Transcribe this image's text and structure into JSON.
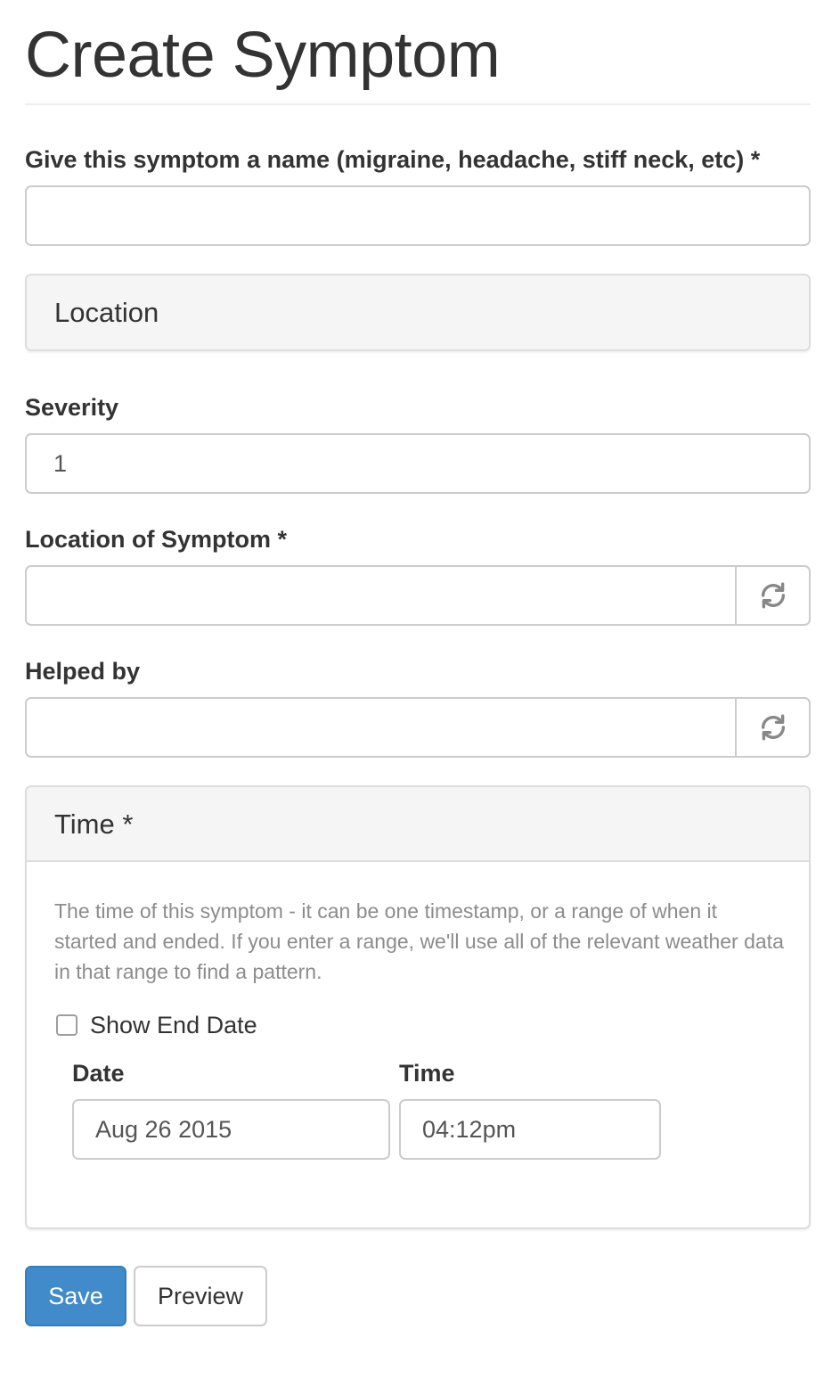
{
  "page": {
    "title": "Create Symptom"
  },
  "form": {
    "name_field": {
      "label": "Give this symptom a name (migraine, headache, stiff neck, etc) *",
      "value": ""
    },
    "location_panel": {
      "heading": "Location"
    },
    "severity_field": {
      "label": "Severity",
      "value": "1"
    },
    "location_of_symptom_field": {
      "label": "Location of Symptom *",
      "value": "",
      "addon_icon": "refresh-icon"
    },
    "helped_by_field": {
      "label": "Helped by",
      "value": "",
      "addon_icon": "refresh-icon"
    },
    "time_panel": {
      "heading": "Time *",
      "help_text": "The time of this symptom - it can be one timestamp, or a range of when it started and ended. If you enter a range, we'll use all of the relevant weather data in that range to find a pattern.",
      "show_end_date": {
        "label": "Show End Date",
        "checked": false
      },
      "date_field": {
        "label": "Date",
        "value": "Aug 26 2015"
      },
      "time_field": {
        "label": "Time",
        "value": "04:12pm"
      }
    },
    "actions": {
      "save_label": "Save",
      "preview_label": "Preview",
      "primary_color": "#428bca"
    }
  }
}
